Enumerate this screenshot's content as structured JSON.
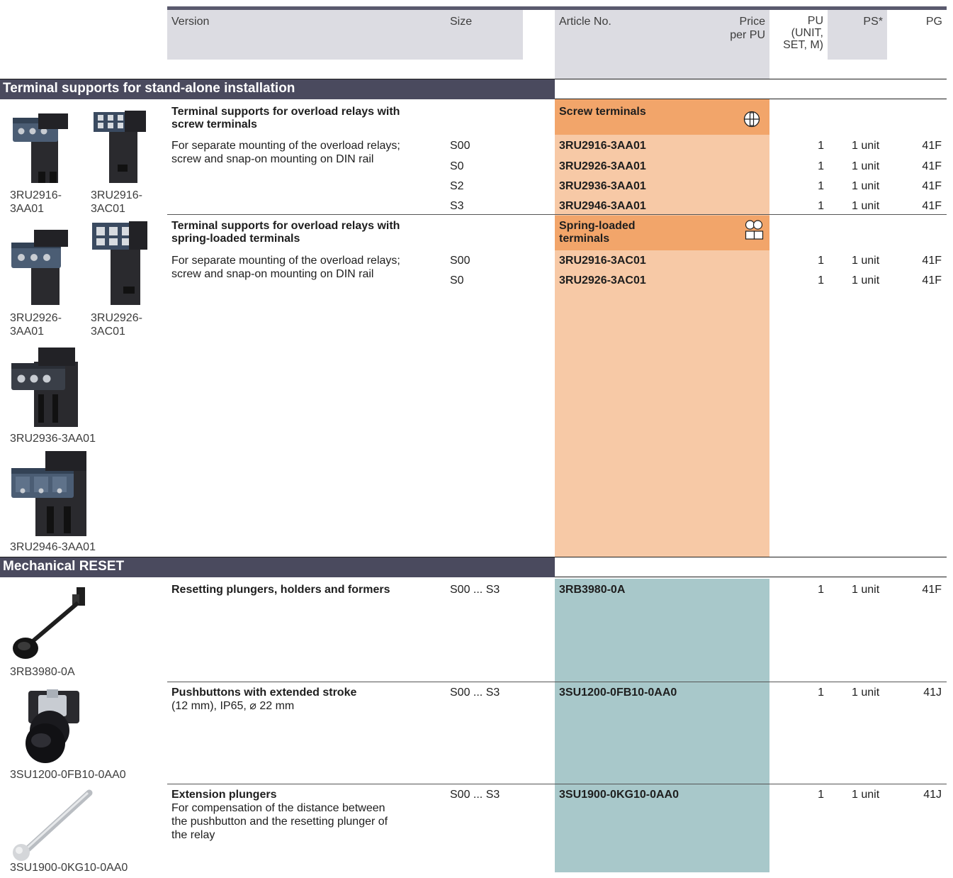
{
  "header": {
    "version": "Version",
    "size": "Size",
    "article_no": "Article No.",
    "price_line1": "Price",
    "price_line2": "per PU",
    "pu_line1": "PU",
    "pu_line2": "(UNIT,",
    "pu_line3": "SET, M)",
    "ps": "PS*",
    "pg": "PG"
  },
  "section1": {
    "title": "Terminal supports for stand-alone installation",
    "group1": {
      "title_line1": "Terminal supports for overload relays with",
      "title_line2": "screw terminals",
      "desc_line1": "For separate mounting of the overload relays;",
      "desc_line2": "screw and snap-on mounting on DIN rail",
      "label": "Screw terminals",
      "icon": "screw-terminal-icon",
      "rows": [
        {
          "size": "S00",
          "article": "3RU2916-3AA01",
          "pu": "1",
          "ps": "1 unit",
          "pg": "41F"
        },
        {
          "size": "S0",
          "article": "3RU2926-3AA01",
          "pu": "1",
          "ps": "1 unit",
          "pg": "41F"
        },
        {
          "size": "S2",
          "article": "3RU2936-3AA01",
          "pu": "1",
          "ps": "1 unit",
          "pg": "41F"
        },
        {
          "size": "S3",
          "article": "3RU2946-3AA01",
          "pu": "1",
          "ps": "1 unit",
          "pg": "41F"
        }
      ]
    },
    "group2": {
      "title_line1": "Terminal supports for overload relays with",
      "title_line2": "spring-loaded terminals",
      "desc_line1": "For separate mounting of the overload relays;",
      "desc_line2": "screw and snap-on mounting on DIN rail",
      "label_line1": "Spring-loaded",
      "label_line2": "terminals",
      "icon": "spring-terminal-icon",
      "rows": [
        {
          "size": "S00",
          "article": "3RU2916-3AC01",
          "pu": "1",
          "ps": "1 unit",
          "pg": "41F"
        },
        {
          "size": "S0",
          "article": "3RU2926-3AC01",
          "pu": "1",
          "ps": "1 unit",
          "pg": "41F"
        }
      ]
    },
    "images": [
      {
        "line1": "3RU2916-",
        "line2": "3AA01"
      },
      {
        "line1": "3RU2916-",
        "line2": "3AC01"
      },
      {
        "line1": "3RU2926-",
        "line2": "3AA01"
      },
      {
        "line1": "3RU2926-",
        "line2": "3AC01"
      },
      {
        "line1": "3RU2936-3AA01"
      },
      {
        "line1": "3RU2946-3AA01"
      }
    ]
  },
  "section2": {
    "title": "Mechanical RESET",
    "items": [
      {
        "title": "Resetting plungers, holders and formers",
        "size": "S00 ... S3",
        "article": "3RB3980-0A",
        "pu": "1",
        "ps": "1 unit",
        "pg": "41F",
        "image_label": "3RB3980-0A"
      },
      {
        "title": "Pushbuttons with extended stroke",
        "desc_line1": "(12 mm), IP65, ⌀ 22 mm",
        "size": "S00 ... S3",
        "article": "3SU1200-0FB10-0AA0",
        "pu": "1",
        "ps": "1 unit",
        "pg": "41J",
        "image_label": "3SU1200-0FB10-0AA0"
      },
      {
        "title": "Extension plungers",
        "desc_line1": "For compensation of the distance between",
        "desc_line2": "the pushbutton and the resetting plunger of",
        "desc_line3": "the relay",
        "size": "S00 ... S3",
        "article": "3SU1900-0KG10-0AA0",
        "pu": "1",
        "ps": "1 unit",
        "pg": "41J",
        "image_label": "3SU1900-0KG10-0AA0"
      }
    ]
  },
  "colors": {
    "header_bg": "#dcdce2",
    "header_bar": "#5a5a6e",
    "section_bar": "#4a4a5e",
    "orange_dark": "#f2a56a",
    "orange_light": "#f7c9a6",
    "teal": "#a8c8ca"
  }
}
